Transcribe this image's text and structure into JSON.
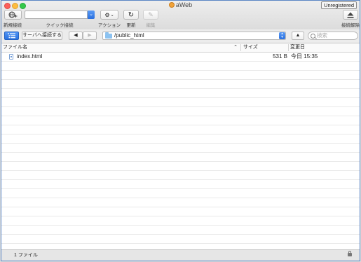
{
  "window": {
    "title": "aWeb",
    "unregistered_label": "Unregistered"
  },
  "toolbar": {
    "new_connection_label": "新規接続",
    "quick_connect_label": "クイック接続",
    "quick_connect_value": "",
    "action_label": "アクション",
    "refresh_label": "更新",
    "edit_label": "編集",
    "disconnect_label": "接続解除"
  },
  "pathbar": {
    "server_connect_label": "サーバへ接続する",
    "path": "/public_html",
    "search_placeholder": "検索"
  },
  "table": {
    "columns": {
      "name": "ファイル名",
      "size": "サイズ",
      "modified": "変更日"
    },
    "rows": [
      {
        "name": "index.html",
        "size": "531 B",
        "modified": "今日 15:35"
      }
    ]
  },
  "status": {
    "file_count": "1 ファイル"
  },
  "icons": {
    "app": "aweb-app-icon",
    "new_connection": "globe-plus-icon",
    "action": "gear-icon",
    "refresh": "refresh-icon",
    "edit": "pencil-icon",
    "disconnect": "eject-icon",
    "folder": "folder-icon",
    "search": "search-icon",
    "lock": "lock-icon"
  },
  "colors": {
    "accent": "#2a72e0",
    "folder": "#8cc2f0",
    "window_border": "#5b86c4"
  }
}
